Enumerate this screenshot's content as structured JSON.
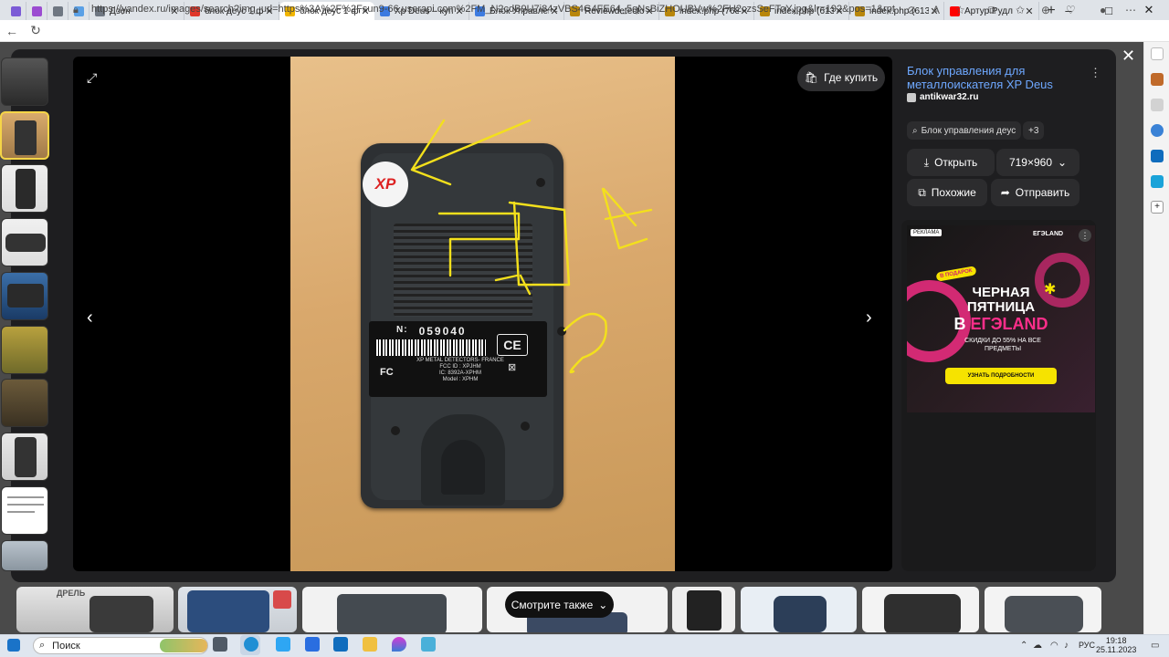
{
  "tabs": [
    {
      "label": "",
      "favicon": "violet",
      "mini": true,
      "active": false
    },
    {
      "label": "",
      "favicon": "purple",
      "mini": true,
      "active": false
    },
    {
      "label": "",
      "favicon": "gray",
      "mini": true,
      "active": false
    },
    {
      "label": "",
      "favicon": "lightblue",
      "mini": true,
      "active": false
    },
    {
      "label": "Дзен",
      "favicon": "gray",
      "mini": false,
      "active": false
    },
    {
      "label": "блок деус 1 фот",
      "favicon": "red",
      "mini": false,
      "active": false
    },
    {
      "label": "блок деус 1 фот",
      "favicon": "yellow",
      "mini": false,
      "active": true
    },
    {
      "label": "Xp Deus – купит",
      "favicon": "blue",
      "mini": false,
      "active": false
    },
    {
      "label": "Блок Управлени",
      "favicon": "blue",
      "mini": false,
      "active": false
    },
    {
      "label": "Reviewdetector",
      "favicon": "orange",
      "mini": false,
      "active": false
    },
    {
      "label": "index.php (768×",
      "favicon": "orange",
      "mini": false,
      "active": false
    },
    {
      "label": "index.php (613×",
      "favicon": "orange",
      "mini": false,
      "active": false
    },
    {
      "label": "index.php (613×",
      "favicon": "orange",
      "mini": false,
      "active": false
    },
    {
      "label": "Артур Рудл",
      "favicon": "youtube",
      "mini": false,
      "active": false
    }
  ],
  "address_bar": {
    "url": "https://yandex.ru/images/search?img_url=https%3A%2F%2Fsun9-66.userapi.com%2FM_N2cdB9U7i84zVBS4G4FE64_5qNsBiZHOUBVw%2FH2czsSeFToY.jpg&lr=192&pos=1&rpt=simage&source=serp&text=блок%..."
  },
  "viewer": {
    "buy_label": "Где купить"
  },
  "info_panel": {
    "title": "Блок управления для металлоискателя XP Deus версия...",
    "site": "antikwar32.ru",
    "tag_label": "Блок управления деус",
    "more_tags": "+3",
    "open_label": "Открыть",
    "size_label": "719×960",
    "similar_label": "Похожие",
    "share_label": "Отправить"
  },
  "ad": {
    "badge": "РЕКЛАМА",
    "brand": "ЕГЭLAND",
    "sticker": "В ПОДАРОК",
    "line1": "ЧЕРНАЯ",
    "line2": "ПЯТНИЦА",
    "line3_prefix": "В",
    "line3_brand": "ЕГЭLAND",
    "discount": "СКИДКИ ДО 55% НА ВСЕ ПРЕДМЕТЫ",
    "cta": "УЗНАТЬ ПОДРОБНОСТИ"
  },
  "photo": {
    "serial_label": "N:",
    "serial": "059040",
    "label_line1": "XP METAL DETECTORS- FRANCE",
    "label_line2": "FCC ID : XPJHM",
    "label_line3": "IC: 8392A-XPHM",
    "label_line4": "Model : XPHM",
    "logo": "XP",
    "ce": "CE",
    "fc": "FC"
  },
  "strip": {
    "see_also_label": "Смотрите также",
    "first_thumb_text": "ДРЕЛЬ"
  },
  "taskbar": {
    "search_placeholder": "Поиск",
    "lang": "РУС",
    "time": "19:18",
    "date": "25.11.2023"
  },
  "colors": {
    "accent_link": "#6ea8ff",
    "selected_thumb": "#f5d547",
    "annotation_yellow": "#f3e01c",
    "ad_pink": "#ff2e8a"
  }
}
